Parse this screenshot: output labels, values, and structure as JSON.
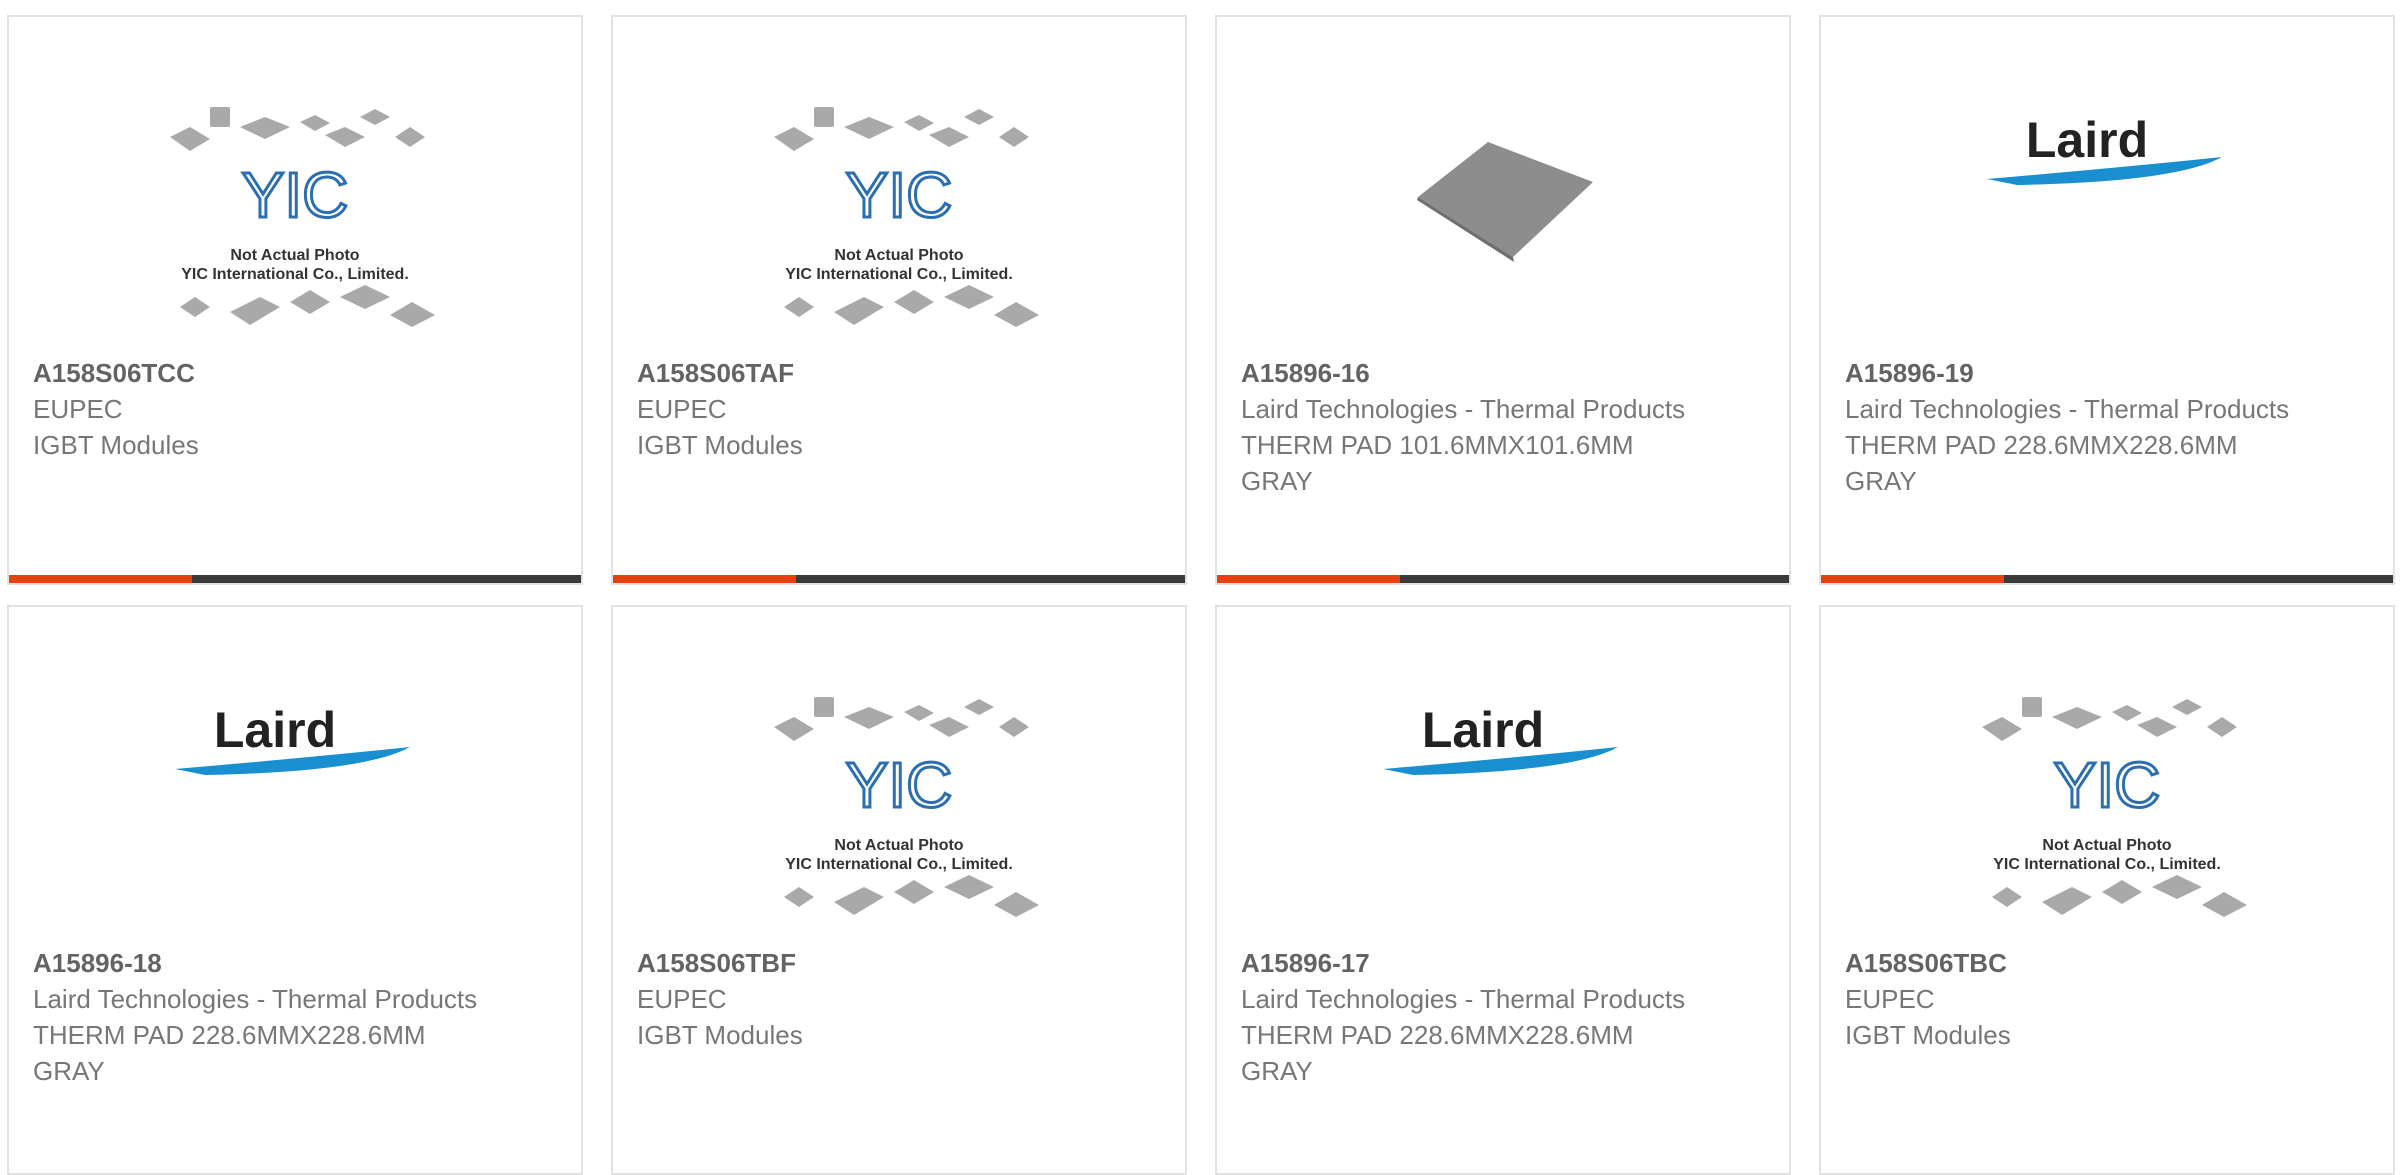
{
  "products": [
    {
      "part": "A158S06TCC",
      "manufacturer": "EUPEC",
      "description": "IGBT Modules",
      "image": "yic-placeholder"
    },
    {
      "part": "A158S06TAF",
      "manufacturer": "EUPEC",
      "description": "IGBT Modules",
      "image": "yic-placeholder"
    },
    {
      "part": "A15896-16",
      "manufacturer": "Laird Technologies - Thermal Products",
      "description": "THERM PAD 101.6MMX101.6MM GRAY",
      "image": "gray-pad-photo"
    },
    {
      "part": "A15896-19",
      "manufacturer": "Laird Technologies - Thermal Products",
      "description": "THERM PAD 228.6MMX228.6MM GRAY",
      "image": "laird-logo"
    },
    {
      "part": "A15896-18",
      "manufacturer": "Laird Technologies - Thermal Products",
      "description": "THERM PAD 228.6MMX228.6MM GRAY",
      "image": "laird-logo"
    },
    {
      "part": "A158S06TBF",
      "manufacturer": "EUPEC",
      "description": "IGBT Modules",
      "image": "yic-placeholder"
    },
    {
      "part": "A15896-17",
      "manufacturer": "Laird Technologies - Thermal Products",
      "description": "THERM PAD 228.6MMX228.6MM GRAY",
      "image": "laird-logo"
    },
    {
      "part": "A158S06TBC",
      "manufacturer": "EUPEC",
      "description": "IGBT Modules",
      "image": "yic-placeholder"
    }
  ],
  "placeholder": {
    "line1": "Not Actual Photo",
    "line2": "YIC International Co., Limited.",
    "logo_text": "YIC"
  },
  "laird_logo_text": "Laird",
  "colors": {
    "accent": "#e8410f",
    "bar": "#3a3a3a",
    "border": "#e2e2e2",
    "text": "#777777",
    "part_text": "#636363",
    "laird_blue": "#1a8fd0"
  }
}
